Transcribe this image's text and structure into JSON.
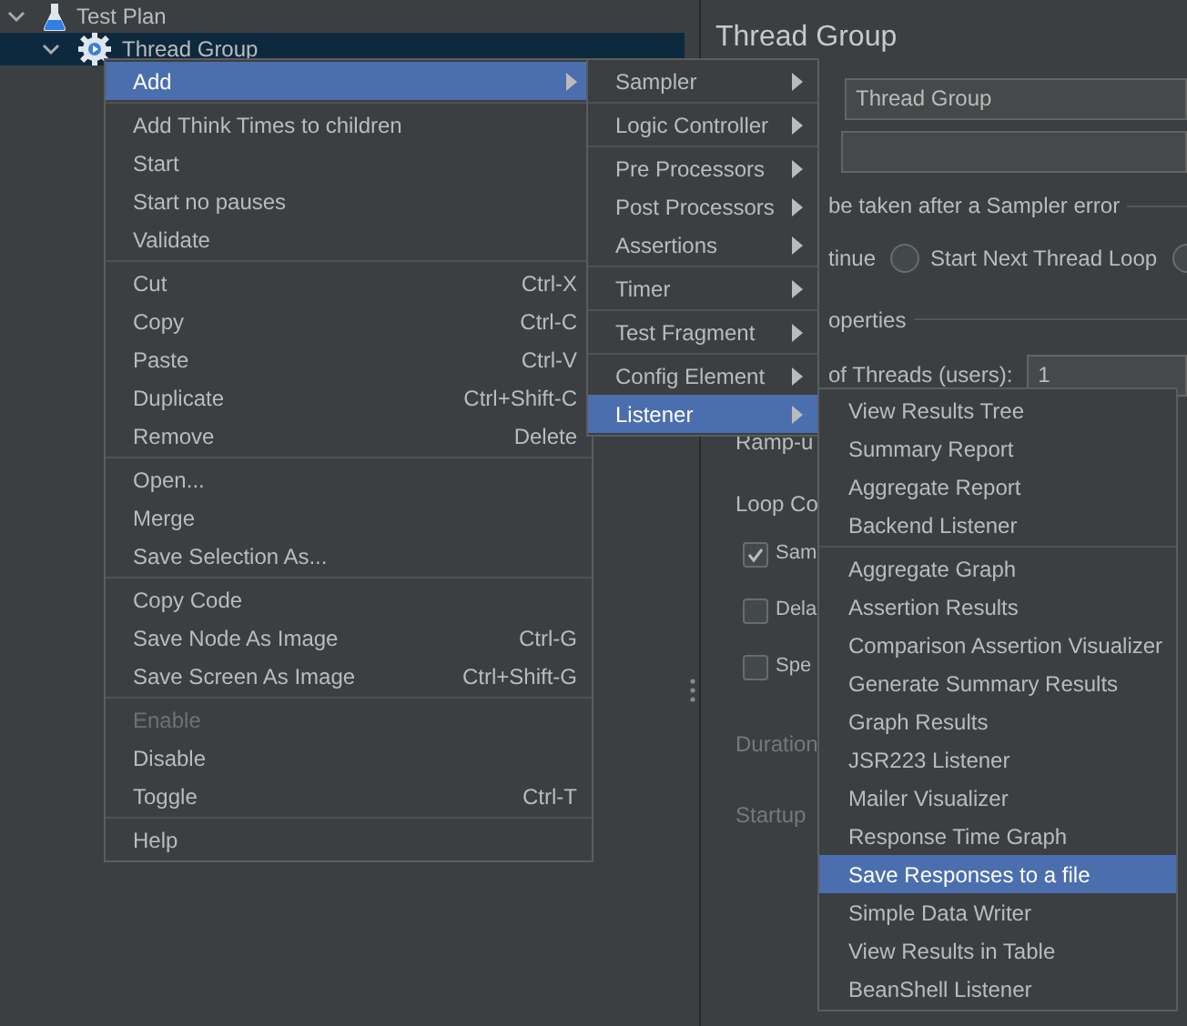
{
  "tree": [
    {
      "label": "Test Plan",
      "expanded": true,
      "selected": false,
      "children": [
        {
          "label": "Thread Group",
          "expanded": true,
          "selected": true
        }
      ]
    }
  ],
  "panel": {
    "title": "Thread Group",
    "name_value": "Thread Group",
    "error_group_label": "be taken after a Sampler error",
    "continue_fragment": "tinue",
    "error_actions": [
      {
        "label": "Start Next Thread Loop",
        "selected": false
      },
      {
        "selected": false
      }
    ],
    "properties_label": "operties",
    "threads_label": "of Threads (users):",
    "threads_value": "1",
    "ramp_label": "Ramp-u",
    "loop_label": "Loop Co",
    "checkboxes": [
      {
        "label": "Sam",
        "checked": true
      },
      {
        "label": "Dela",
        "checked": false
      },
      {
        "label": "Spe",
        "checked": false
      }
    ],
    "disabled_labels": [
      "Duration",
      "Startup"
    ]
  },
  "context_menu": {
    "groups": [
      [
        {
          "label": "Add",
          "submenu": true,
          "selected": true,
          "disabled": false
        }
      ],
      [
        {
          "label": "Add Think Times to children",
          "submenu": false,
          "selected": false,
          "disabled": false
        },
        {
          "label": "Start",
          "submenu": false,
          "selected": false,
          "disabled": false
        },
        {
          "label": "Start no pauses",
          "submenu": false,
          "selected": false,
          "disabled": false
        },
        {
          "label": "Validate",
          "submenu": false,
          "selected": false,
          "disabled": false
        }
      ],
      [
        {
          "label": "Cut",
          "shortcut": "Ctrl-X",
          "submenu": false,
          "selected": false,
          "disabled": false
        },
        {
          "label": "Copy",
          "shortcut": "Ctrl-C",
          "submenu": false,
          "selected": false,
          "disabled": false
        },
        {
          "label": "Paste",
          "shortcut": "Ctrl-V",
          "submenu": false,
          "selected": false,
          "disabled": false
        },
        {
          "label": "Duplicate",
          "shortcut": "Ctrl+Shift-C",
          "submenu": false,
          "selected": false,
          "disabled": false
        },
        {
          "label": "Remove",
          "shortcut": "Delete",
          "submenu": false,
          "selected": false,
          "disabled": false
        }
      ],
      [
        {
          "label": "Open...",
          "submenu": false,
          "selected": false,
          "disabled": false
        },
        {
          "label": "Merge",
          "submenu": false,
          "selected": false,
          "disabled": false
        },
        {
          "label": "Save Selection As...",
          "submenu": false,
          "selected": false,
          "disabled": false
        }
      ],
      [
        {
          "label": "Copy Code",
          "submenu": false,
          "selected": false,
          "disabled": false
        },
        {
          "label": "Save Node As Image",
          "shortcut": "Ctrl-G",
          "submenu": false,
          "selected": false,
          "disabled": false
        },
        {
          "label": "Save Screen As Image",
          "shortcut": "Ctrl+Shift-G",
          "submenu": false,
          "selected": false,
          "disabled": false
        }
      ],
      [
        {
          "label": "Enable",
          "submenu": false,
          "selected": false,
          "disabled": true
        },
        {
          "label": "Disable",
          "submenu": false,
          "selected": false,
          "disabled": false
        },
        {
          "label": "Toggle",
          "shortcut": "Ctrl-T",
          "submenu": false,
          "selected": false,
          "disabled": false
        }
      ],
      [
        {
          "label": "Help",
          "submenu": false,
          "selected": false,
          "disabled": false
        }
      ]
    ]
  },
  "add_submenu": {
    "groups": [
      [
        {
          "label": "Sampler",
          "submenu": true,
          "selected": false
        }
      ],
      [
        {
          "label": "Logic Controller",
          "submenu": true,
          "selected": false
        }
      ],
      [
        {
          "label": "Pre Processors",
          "submenu": true,
          "selected": false
        },
        {
          "label": "Post Processors",
          "submenu": true,
          "selected": false
        },
        {
          "label": "Assertions",
          "submenu": true,
          "selected": false
        }
      ],
      [
        {
          "label": "Timer",
          "submenu": true,
          "selected": false
        }
      ],
      [
        {
          "label": "Test Fragment",
          "submenu": true,
          "selected": false
        }
      ],
      [
        {
          "label": "Config Element",
          "submenu": true,
          "selected": false
        },
        {
          "label": "Listener",
          "submenu": true,
          "selected": true
        }
      ]
    ]
  },
  "listener_submenu": {
    "groups": [
      [
        {
          "label": "View Results Tree",
          "selected": false
        },
        {
          "label": "Summary Report",
          "selected": false
        },
        {
          "label": "Aggregate Report",
          "selected": false
        },
        {
          "label": "Backend Listener",
          "selected": false
        }
      ],
      [
        {
          "label": "Aggregate Graph",
          "selected": false
        },
        {
          "label": "Assertion Results",
          "selected": false
        },
        {
          "label": "Comparison Assertion Visualizer",
          "selected": false
        },
        {
          "label": "Generate Summary Results",
          "selected": false
        },
        {
          "label": "Graph Results",
          "selected": false
        },
        {
          "label": "JSR223 Listener",
          "selected": false
        },
        {
          "label": "Mailer Visualizer",
          "selected": false
        },
        {
          "label": "Response Time Graph",
          "selected": false
        },
        {
          "label": "Save Responses to a file",
          "selected": true
        },
        {
          "label": "Simple Data Writer",
          "selected": false
        },
        {
          "label": "View Results in Table",
          "selected": false
        },
        {
          "label": "BeanShell Listener",
          "selected": false
        }
      ]
    ]
  }
}
